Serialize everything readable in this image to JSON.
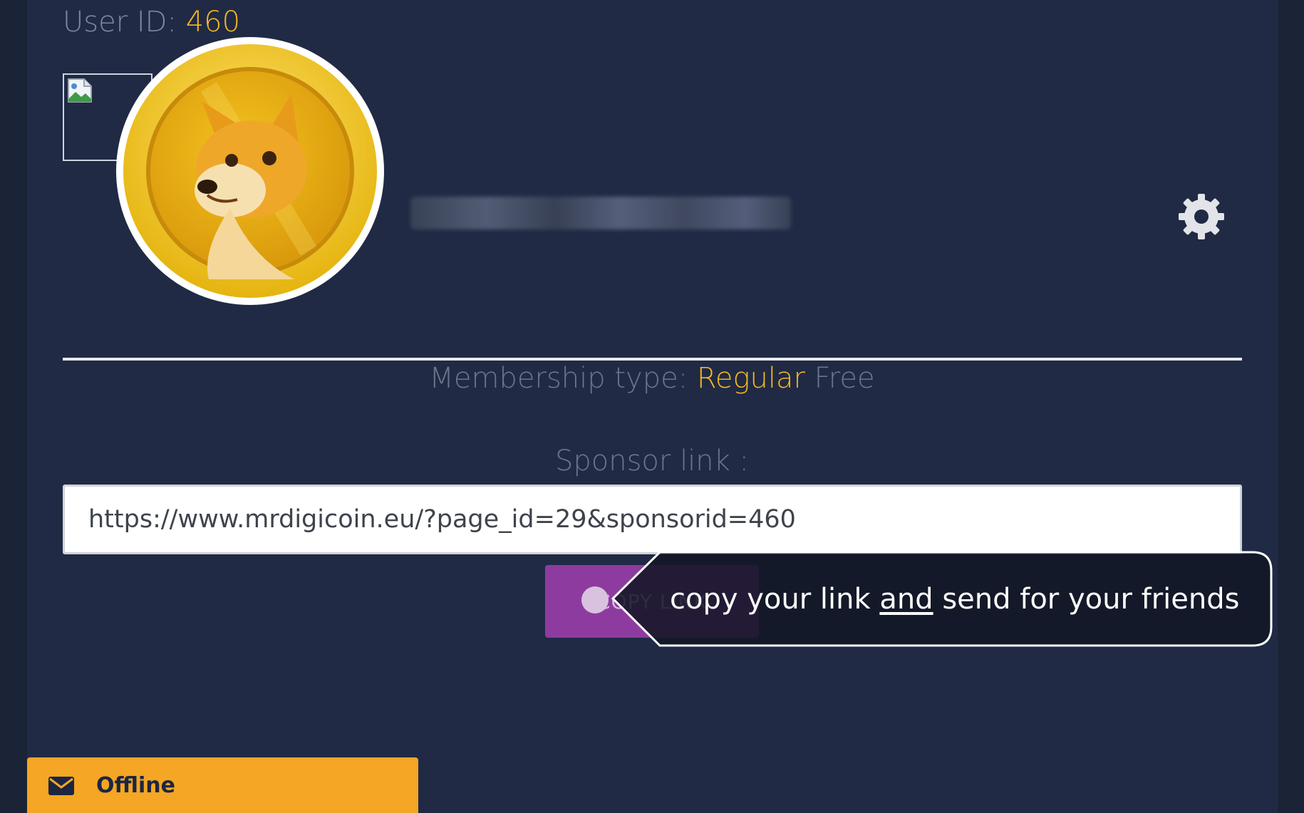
{
  "user": {
    "id_label": "User ID:",
    "id_value": "460"
  },
  "membership": {
    "label": "Membership type:",
    "tier": "Regular",
    "plan": "Free"
  },
  "sponsor": {
    "label": "Sponsor link :",
    "link": "https://www.mrdigicoin.eu/?page_id=29&sponsorid=460",
    "copy_button_label": "COPY LINK"
  },
  "tooltip": {
    "text_before": "copy your link",
    "text_underlined": "and",
    "text_after": "send for your friends"
  },
  "chat": {
    "status_label": "Offline"
  },
  "colors": {
    "background": "#202a44",
    "accent": "#f6b722",
    "copy_button": "#8e3b9f",
    "chat_bar": "#f4a624"
  },
  "icons": {
    "settings": "gear-icon",
    "chat": "mail-icon",
    "avatar": "dogecoin-icon",
    "broken_image": "broken-image-icon"
  }
}
